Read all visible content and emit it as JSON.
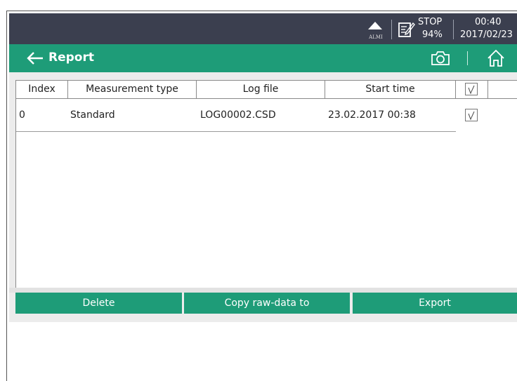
{
  "statusbar": {
    "alarm_label": "ALMI",
    "measurement_state": "STOP",
    "battery": "94%",
    "time": "00:40",
    "date": "2017/02/23"
  },
  "titlebar": {
    "title": "Report"
  },
  "table": {
    "headers": {
      "index": "Index",
      "measurement_type": "Measurement type",
      "log_file": "Log file",
      "start_time": "Start time"
    },
    "rows": [
      {
        "index": "0",
        "measurement_type": "Standard",
        "log_file": "LOG00002.CSD",
        "start_time": "23.02.2017 00:38",
        "checked": true
      }
    ]
  },
  "buttons": {
    "delete": "Delete",
    "copy_raw": "Copy raw-data to",
    "export": "Export"
  },
  "colors": {
    "accent": "#1e9c78",
    "status_bar": "#3b3f4f"
  },
  "icons": {
    "back": "arrow-left-icon",
    "camera": "camera-icon",
    "home": "home-icon",
    "alarm": "alarm-triangle-icon",
    "memo": "memo-edit-icon",
    "checkbox": "checkmark-icon"
  }
}
